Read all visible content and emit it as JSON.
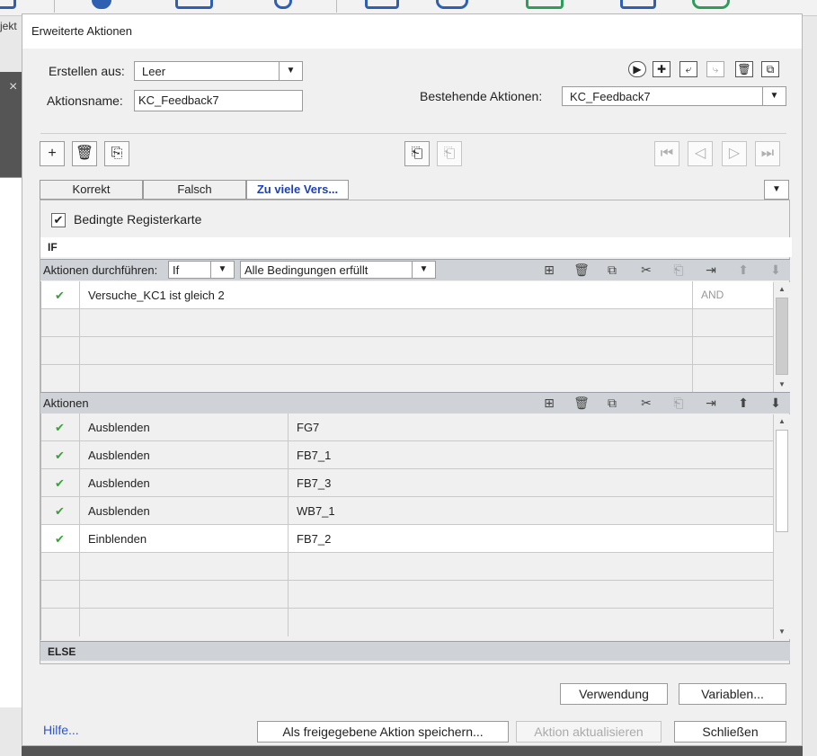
{
  "background_app": {
    "side_label": "jekt"
  },
  "dialog": {
    "title": "Erweiterte Aktionen",
    "create_from": {
      "label": "Erstellen aus:",
      "value": "Leer"
    },
    "action_name": {
      "label": "Aktionsname:",
      "value": "KC_Feedback7"
    },
    "existing_actions": {
      "label": "Bestehende Aktionen:",
      "value": "KC_Feedback7"
    },
    "tabs": [
      {
        "label": "Korrekt"
      },
      {
        "label": "Falsch"
      },
      {
        "label": "Zu viele Vers..."
      }
    ],
    "conditional_tab": {
      "label": "Bedingte Registerkarte",
      "checked": true
    },
    "if_label": "IF",
    "conditions_header": {
      "label": "Aktionen durchführen:",
      "if_value": "If",
      "mode_value": "Alle Bedingungen erfüllt"
    },
    "conditions": [
      {
        "enabled": true,
        "expression": "Versuche_KC1   ist gleich   2",
        "operator": "AND"
      }
    ],
    "actions_header": {
      "label": "Aktionen"
    },
    "actions": [
      {
        "enabled": true,
        "action": "Ausblenden",
        "target": "FG7"
      },
      {
        "enabled": true,
        "action": "Ausblenden",
        "target": "FB7_1"
      },
      {
        "enabled": true,
        "action": "Ausblenden",
        "target": "FB7_3"
      },
      {
        "enabled": true,
        "action": "Ausblenden",
        "target": "WB7_1"
      },
      {
        "enabled": true,
        "action": "Einblenden",
        "target": "FB7_2"
      }
    ],
    "else_label": "ELSE",
    "buttons": {
      "usage": "Verwendung",
      "variables": "Variablen...",
      "help": "Hilfe...",
      "save_shared": "Als freigegebene Aktion speichern...",
      "update_action": "Aktion aktualisieren",
      "close": "Schließen"
    },
    "checkmark": "✔",
    "colors": {
      "accent": "#1c3fbd",
      "check": "#3aa23a",
      "link": "#2e56c9"
    }
  }
}
